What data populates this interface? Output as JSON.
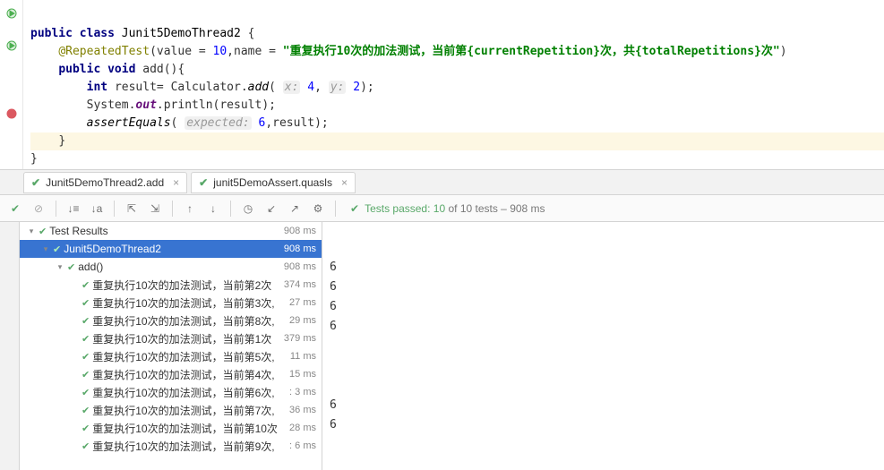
{
  "code": {
    "kw_public": "public",
    "kw_class": "class",
    "cls_name": "Junit5DemoThread2",
    "ann": "@RepeatedTest",
    "ann_args_pre": "(value = ",
    "ann_val": "10",
    "ann_mid": ",name = ",
    "ann_str": "\"重复执行10次的加法测试，当前第{currentRepetition}次，共{totalRepetitions}次\"",
    "ann_post": ")",
    "kw_void": "void",
    "m_add": "add",
    "m_sig": "(){",
    "kw_int": "int",
    "v_result": "result",
    "eq": "= ",
    "calc": "Calculator.",
    "m_addc": "add",
    "lp": "( ",
    "h_x": "x:",
    "n_x": "4",
    "comma": ", ",
    "h_y": "y:",
    "n_y": "2",
    "rp": ");",
    "sys": "System.",
    "out": "out",
    "pl": ".println",
    "parg": "(result);",
    "ae": "assertEquals",
    "ae_lp": "( ",
    "h_exp": "expected:",
    "n_exp": "6",
    "ae_mid": ",result);",
    "brace": "}"
  },
  "tabs": [
    {
      "label": "Junit5DemoThread2.add"
    },
    {
      "label": "junit5DemoAssert.quasls"
    }
  ],
  "status": {
    "passed_label": "Tests passed:",
    "count": "10",
    "rest": "of 10 tests – 908 ms"
  },
  "tree": {
    "root": {
      "label": "Test Results",
      "ms": "908 ms"
    },
    "class": {
      "label": "Junit5DemoThread2",
      "ms": "908 ms"
    },
    "method": {
      "label": "add()",
      "ms": "908 ms"
    },
    "items": [
      {
        "label": "重复执行10次的加法测试，当前第2次",
        "ms": "374 ms"
      },
      {
        "label": "重复执行10次的加法测试，当前第3次,",
        "ms": "27 ms"
      },
      {
        "label": "重复执行10次的加法测试，当前第8次,",
        "ms": "29 ms"
      },
      {
        "label": "重复执行10次的加法测试，当前第1次",
        "ms": "379 ms"
      },
      {
        "label": "重复执行10次的加法测试，当前第5次,",
        "ms": "11 ms"
      },
      {
        "label": "重复执行10次的加法测试，当前第4次,",
        "ms": "15 ms"
      },
      {
        "label": "重复执行10次的加法测试，当前第6次,",
        "ms": ": 3 ms"
      },
      {
        "label": "重复执行10次的加法测试，当前第7次,",
        "ms": "36 ms"
      },
      {
        "label": "重复执行10次的加法测试，当前第10次",
        "ms": "28 ms"
      },
      {
        "label": "重复执行10次的加法测试，当前第9次,",
        "ms": ": 6 ms"
      }
    ]
  },
  "output": [
    "6",
    "6",
    "6",
    "6",
    "",
    "",
    "",
    "6",
    "6"
  ]
}
